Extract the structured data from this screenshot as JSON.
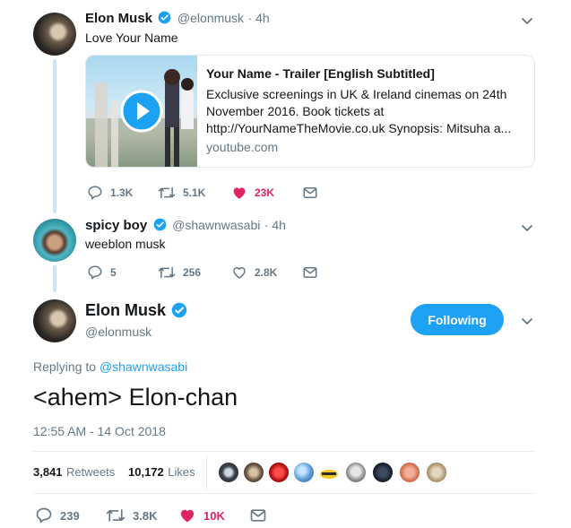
{
  "tweets": [
    {
      "name": "Elon Musk",
      "handle": "@elonmusk",
      "time": "· 4h",
      "text": "Love Your Name",
      "card": {
        "title": "Your Name - Trailer [English Subtitled]",
        "description": "Exclusive screenings in UK & Ireland cinemas on 24th November 2016. Book tickets at http://YourNameTheMovie.co.uk Synopsis: Mitsuha a...",
        "domain": "youtube.com"
      },
      "actions": {
        "replies": "1.3K",
        "retweets": "5.1K",
        "likes": "23K"
      }
    },
    {
      "name": "spicy boy",
      "handle": "@shawnwasabi",
      "time": "· 4h",
      "text": "weeblon musk",
      "actions": {
        "replies": "5",
        "retweets": "256",
        "likes": "2.8K"
      }
    }
  ],
  "main": {
    "name": "Elon Musk",
    "handle": "@elonmusk",
    "follow_label": "Following",
    "replying_prefix": "Replying to",
    "replying_handle": "@shawnwasabi",
    "text": "<ahem> Elon-chan",
    "timestamp": "12:55 AM - 14 Oct 2018",
    "stats": {
      "retweets": "3,841",
      "retweets_label": "Retweets",
      "likes": "10,172",
      "likes_label": "Likes"
    },
    "actions": {
      "replies": "239",
      "retweets": "3.8K",
      "likes": "10K"
    }
  },
  "colors": {
    "accent": "#1da1f2",
    "like": "#e0245e",
    "muted": "#657786"
  }
}
